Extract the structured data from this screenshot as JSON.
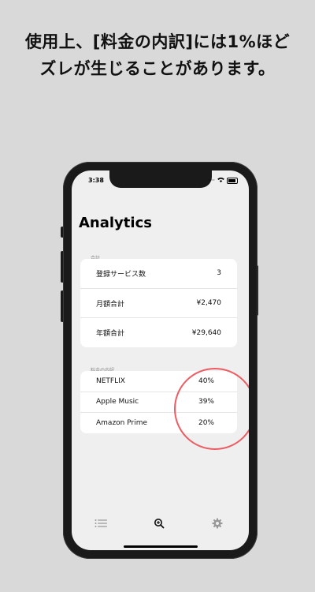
{
  "caption": {
    "line1": "使用上、[料金の内訳]には1%ほど",
    "line2": "ズレが生じることがあります。"
  },
  "status": {
    "time": "3:38"
  },
  "page": {
    "title": "Analytics"
  },
  "summary": {
    "label": "合計",
    "rows": [
      {
        "label": "登録サービス数",
        "value": "3"
      },
      {
        "label": "月額合計",
        "value": "¥2,470"
      },
      {
        "label": "年額合計",
        "value": "¥29,640"
      }
    ]
  },
  "breakdown": {
    "label": "料金の内訳",
    "rows": [
      {
        "label": "NETFLIX",
        "value": "40%"
      },
      {
        "label": "Apple Music",
        "value": "39%"
      },
      {
        "label": "Amazon Prime",
        "value": "20%"
      }
    ]
  },
  "tabs": [
    {
      "name": "list-icon",
      "active": false
    },
    {
      "name": "zoom-in-icon",
      "active": true
    },
    {
      "name": "gear-icon",
      "active": false
    }
  ],
  "colors": {
    "highlight_circle": "#ee5c63",
    "screen_bg": "#efefef"
  }
}
